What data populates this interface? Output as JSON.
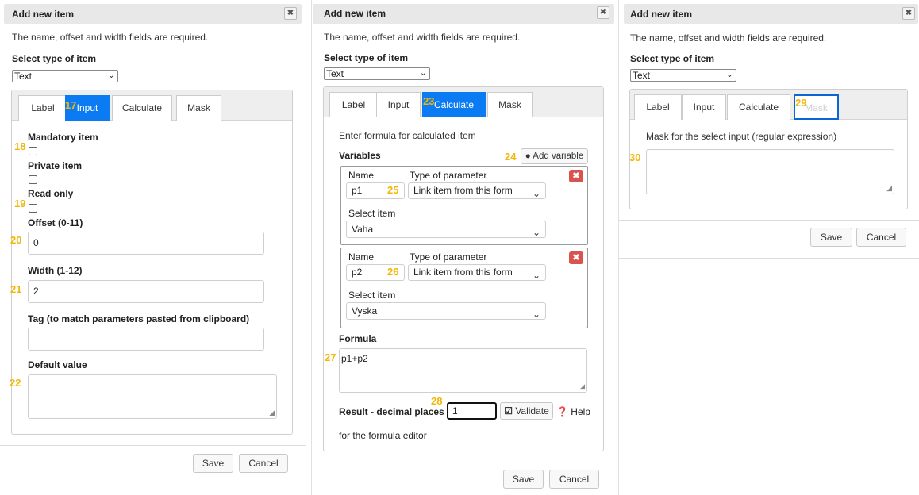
{
  "dialog": {
    "title": "Add new item",
    "hint": "The name, offset and width fields are required.",
    "type_label": "Select type of item",
    "type_value": "Text",
    "close_glyph": "✖",
    "save_label": "Save",
    "cancel_label": "Cancel"
  },
  "tabs": [
    "Label",
    "Input",
    "Calculate",
    "Mask"
  ],
  "markers": {
    "input_tab": "17",
    "mandatory": "18",
    "readonly": "19",
    "offset": "20",
    "width": "21",
    "default": "22",
    "calculate_tab": "23",
    "add_variable": "24",
    "var1_name": "25",
    "var2_name": "26",
    "formula": "27",
    "decimal": "28",
    "mask_tab": "29",
    "mask_input": "30"
  },
  "input_panel": {
    "mandatory_label": "Mandatory item",
    "private_label": "Private item",
    "readonly_label": "Read only",
    "offset_label": "Offset (0-11)",
    "offset_value": "0",
    "width_label": "Width (1-12)",
    "width_value": "2",
    "tag_label": "Tag (to match parameters pasted from clipboard)",
    "tag_value": "",
    "default_label": "Default value",
    "default_value": ""
  },
  "calculate_panel": {
    "intro": "Enter formula for calculated item",
    "variables_label": "Variables",
    "add_variable_label": "Add variable",
    "name_header": "Name",
    "type_header": "Type of parameter",
    "select_item_label": "Select item",
    "variables": [
      {
        "name": "p1",
        "type": "Link item from this form",
        "item": "Vaha"
      },
      {
        "name": "p2",
        "type": "Link item from this form",
        "item": "Vyska"
      }
    ],
    "formula_label": "Formula",
    "formula_value": "p1+p2",
    "decimal_label": "Result - decimal places",
    "decimal_value": "1",
    "validate_label": "Validate",
    "help_label": "Help",
    "help_suffix": "for the formula editor"
  },
  "mask_panel": {
    "mask_hint": "Mask for the select input (regular expression)",
    "mask_value": ""
  }
}
